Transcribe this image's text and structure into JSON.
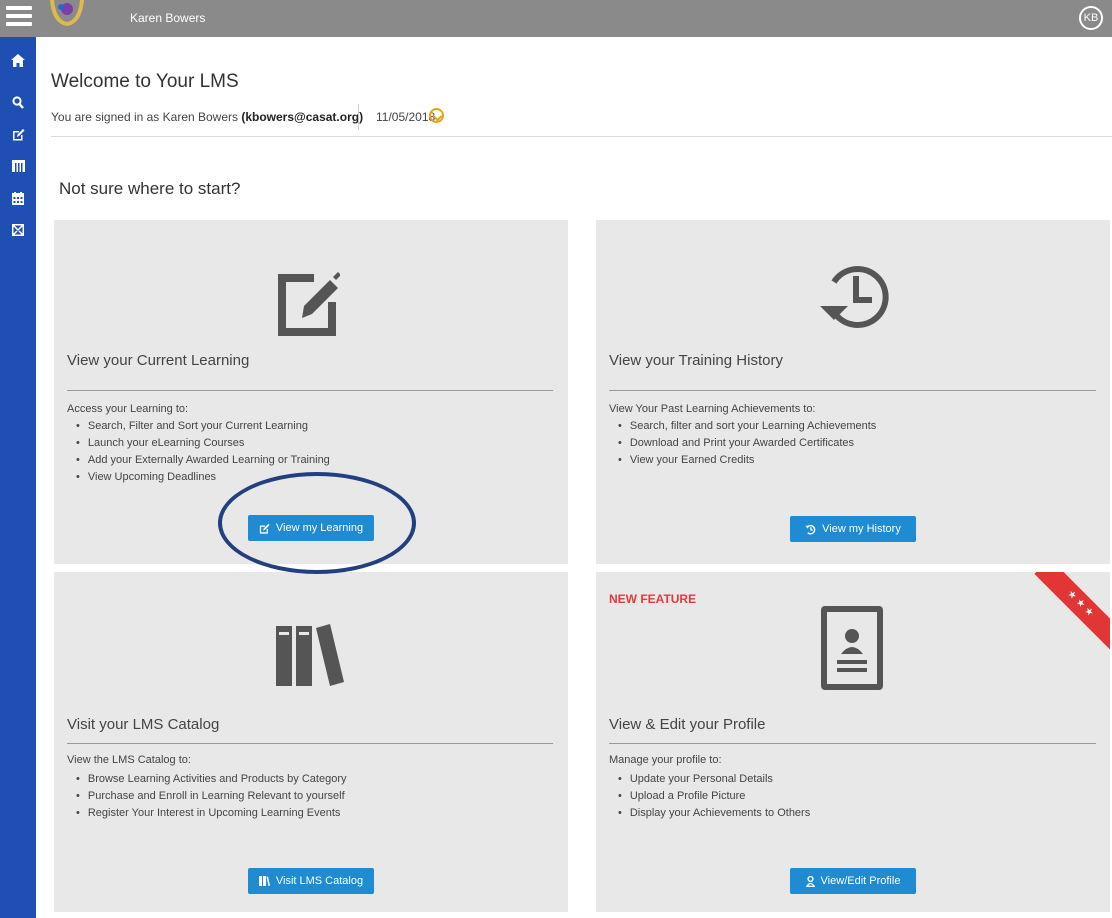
{
  "header": {
    "user_name": "Karen Bowers",
    "avatar_initials": "KB"
  },
  "sidebar": {
    "items": [
      {
        "icon": "home-icon"
      },
      {
        "icon": "search-icon"
      },
      {
        "icon": "edit-icon"
      },
      {
        "icon": "catalog-icon"
      },
      {
        "icon": "calendar-icon"
      },
      {
        "icon": "messages-icon"
      }
    ]
  },
  "welcome": {
    "title": "Welcome to Your LMS",
    "signed_in_prefix": "You are signed in as Karen Bowers ",
    "signed_in_email": "(kbowers@casat.org)",
    "date": "11/05/2018"
  },
  "subheading": "Not sure where to start?",
  "cards": {
    "learning": {
      "title": "View your Current Learning",
      "intro": "Access your Learning to:",
      "items": [
        "Search, Filter and Sort your Current Learning",
        "Launch your eLearning Courses",
        "Add your Externally Awarded Learning or Training",
        "View Upcoming Deadlines"
      ],
      "button": "View my Learning"
    },
    "history": {
      "title": "View your Training History",
      "intro": "View Your Past Learning Achievements to:",
      "items": [
        "Search, filter and sort your Learning Achievements",
        "Download and Print your Awarded Certificates",
        "View your Earned Credits"
      ],
      "button": "View my History"
    },
    "catalog": {
      "title": "Visit your LMS Catalog",
      "intro": "View the LMS Catalog to:",
      "items": [
        "Browse Learning Activities and Products by Category",
        "Purchase and Enroll in Learning Relevant to yourself",
        "Register Your Interest in Upcoming Learning Events"
      ],
      "button": "Visit LMS Catalog"
    },
    "profile": {
      "badge": "NEW FEATURE",
      "title": "View & Edit your Profile",
      "intro": "Manage your profile to:",
      "items": [
        "Update your Personal Details",
        "Upload a Profile Picture",
        "Display your Achievements to Others"
      ],
      "button": "View/Edit Profile"
    }
  },
  "colors": {
    "topbar": "#8a8a8a",
    "sidebar": "#1f4fb2",
    "button": "#1e8bd3",
    "card": "#e8e8e8",
    "new_feature": "#e03c3c",
    "highlight": "#233f7f"
  }
}
